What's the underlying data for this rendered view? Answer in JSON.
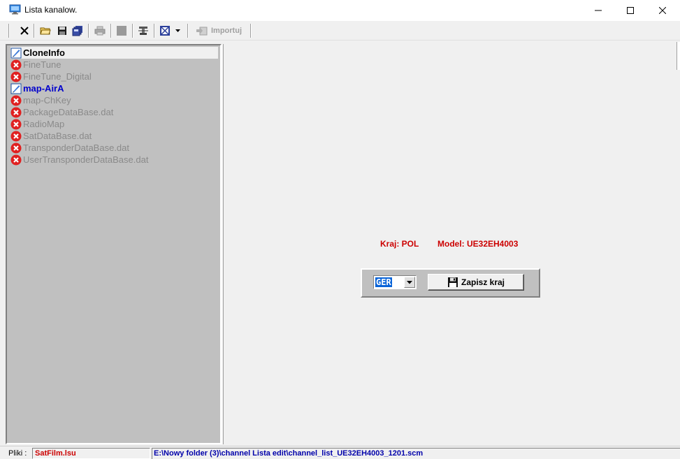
{
  "window": {
    "title": "Lista kanalow.",
    "icon": "monitor-icon"
  },
  "toolbar": {
    "items": [
      {
        "name": "close-file-button",
        "icon": "x-icon",
        "enabled": true
      },
      {
        "name": "open-button",
        "icon": "open-folder-icon",
        "enabled": true
      },
      {
        "name": "save-button",
        "icon": "floppy-icon",
        "enabled": true
      },
      {
        "name": "save-all-button",
        "icon": "floppy-multi-icon",
        "enabled": true
      },
      {
        "name": "print-button",
        "icon": "printer-icon",
        "enabled": false
      },
      {
        "name": "stop-button",
        "icon": "square-icon",
        "enabled": false
      },
      {
        "name": "tools-button",
        "icon": "tools-icon",
        "enabled": true
      },
      {
        "name": "view-dropdown-button",
        "icon": "grid-icon",
        "enabled": true
      }
    ],
    "import_label": "Importuj"
  },
  "tree": {
    "items": [
      {
        "label": "CloneInfo",
        "icon": "edit-icon",
        "state": "selected"
      },
      {
        "label": "FineTune",
        "icon": "error-icon",
        "state": "disabled"
      },
      {
        "label": "FineTune_Digital",
        "icon": "error-icon",
        "state": "disabled"
      },
      {
        "label": "map-AirA",
        "icon": "edit-icon",
        "state": "active"
      },
      {
        "label": "map-ChKey",
        "icon": "error-icon",
        "state": "disabled"
      },
      {
        "label": "PackageDataBase.dat",
        "icon": "error-icon",
        "state": "disabled"
      },
      {
        "label": "RadioMap",
        "icon": "error-icon",
        "state": "disabled"
      },
      {
        "label": "SatDataBase.dat",
        "icon": "error-icon",
        "state": "disabled"
      },
      {
        "label": "TransponderDataBase.dat",
        "icon": "error-icon",
        "state": "disabled"
      },
      {
        "label": "UserTransponderDataBase.dat",
        "icon": "error-icon",
        "state": "disabled"
      }
    ]
  },
  "info": {
    "kraj": "Kraj: POL",
    "model": "Model: UE32EH4003"
  },
  "country": {
    "selected": "GER",
    "save_label": "Zapisz kraj"
  },
  "status": {
    "files_label": "Pliki :",
    "file": "SatFilm.lsu",
    "path": "E:\\Nowy folder (3)\\channel Lista edit\\channel_list_UE32EH4003_1201.scm"
  },
  "colors": {
    "info_text": "#cc0000",
    "active_item": "#0000cc",
    "disabled_item": "#8a8a8a",
    "tree_bg": "#c0c0c0",
    "path_text": "#0000aa"
  }
}
